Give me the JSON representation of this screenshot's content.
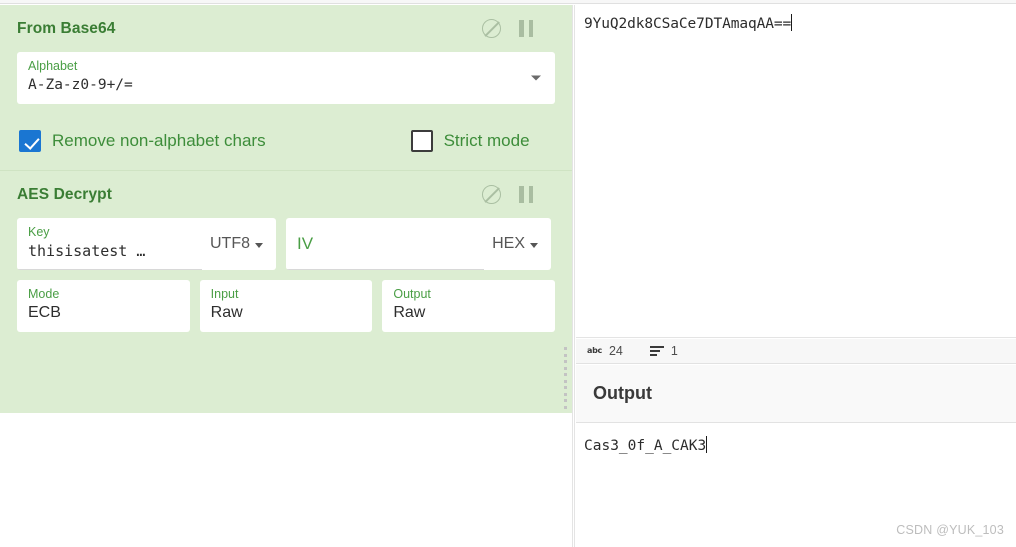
{
  "recipe": {
    "operations": [
      {
        "title": "From Base64",
        "icons": {
          "disable": "ban-icon",
          "pause": "pause-icon"
        },
        "args": {
          "alphabet": {
            "label": "Alphabet",
            "value": "A-Za-z0-9+/="
          },
          "remove_non_alphabet": {
            "label": "Remove non-alphabet chars",
            "checked": true
          },
          "strict_mode": {
            "label": "Strict mode",
            "checked": false
          }
        }
      },
      {
        "title": "AES Decrypt",
        "icons": {
          "disable": "ban-icon",
          "pause": "pause-icon"
        },
        "args": {
          "key": {
            "label": "Key",
            "value": "thisisatest …",
            "encoding": "UTF8"
          },
          "iv": {
            "label": "IV",
            "value": "",
            "encoding": "HEX"
          },
          "mode": {
            "label": "Mode",
            "value": "ECB"
          },
          "input": {
            "label": "Input",
            "value": "Raw"
          },
          "output": {
            "label": "Output",
            "value": "Raw"
          }
        }
      }
    ]
  },
  "input": {
    "value": "9YuQ2dk8CSaCe7DTAmaqAA==",
    "status": {
      "length_icon": "abc",
      "length": "24",
      "lines_icon": "lines-icon",
      "lines": "1"
    }
  },
  "output": {
    "title": "Output",
    "value": "Cas3_0f_A_CAK3"
  },
  "watermark": "CSDN @YUK_103",
  "colors": {
    "recipe_bg": "#dcedd2",
    "op_title": "#3a7d34",
    "arg_label": "#4a9e45",
    "checkbox_checked": "#1a76d2"
  }
}
